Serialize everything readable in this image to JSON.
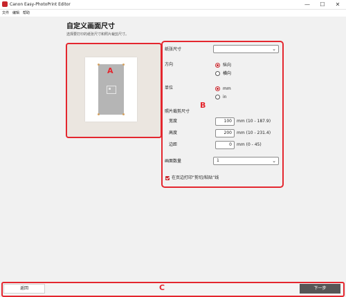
{
  "window": {
    "title": "Canon Easy-PhotoPrint Editor",
    "controls": {
      "minimize": "—",
      "maximize": "☐",
      "close": "✕"
    }
  },
  "menu": [
    "文件",
    "编辑",
    "帮助"
  ],
  "page": {
    "title": "自定义画面尺寸",
    "subtitle": "选择要打印的纸张尺寸和照片裁剪尺寸。"
  },
  "labels": {
    "a": "A",
    "b": "B",
    "c": "C"
  },
  "settings": {
    "paper_size": {
      "label": "纸张尺寸",
      "value": ""
    },
    "orientation": {
      "label": "方向",
      "options": [
        "纵向",
        "横向"
      ],
      "selected": 0
    },
    "unit": {
      "label": "单位",
      "options": [
        "mm",
        "in"
      ],
      "selected": 0
    },
    "crop": {
      "label": "照片裁剪尺寸",
      "width": {
        "label": "宽度",
        "value": "100",
        "range": "mm (10 - 187.9)"
      },
      "height": {
        "label": "高度",
        "value": "200",
        "range": "mm (10 - 231.4)"
      },
      "margin": {
        "label": "边距",
        "value": "0",
        "range": "mm (0 - 45)"
      }
    },
    "count": {
      "label": "画面数量",
      "value": "1"
    },
    "print_cut_lines": {
      "label": "在页边打印“剪切/粘贴”线",
      "checked": true
    }
  },
  "footer": {
    "back_label": "返回",
    "next_label": "下一步"
  },
  "colors": {
    "accent": "#e4262e",
    "brand": "#c7252b",
    "next_button": "#565656"
  },
  "icons": {
    "dropdown": "chevron-down-icon",
    "photo": "image-icon"
  }
}
